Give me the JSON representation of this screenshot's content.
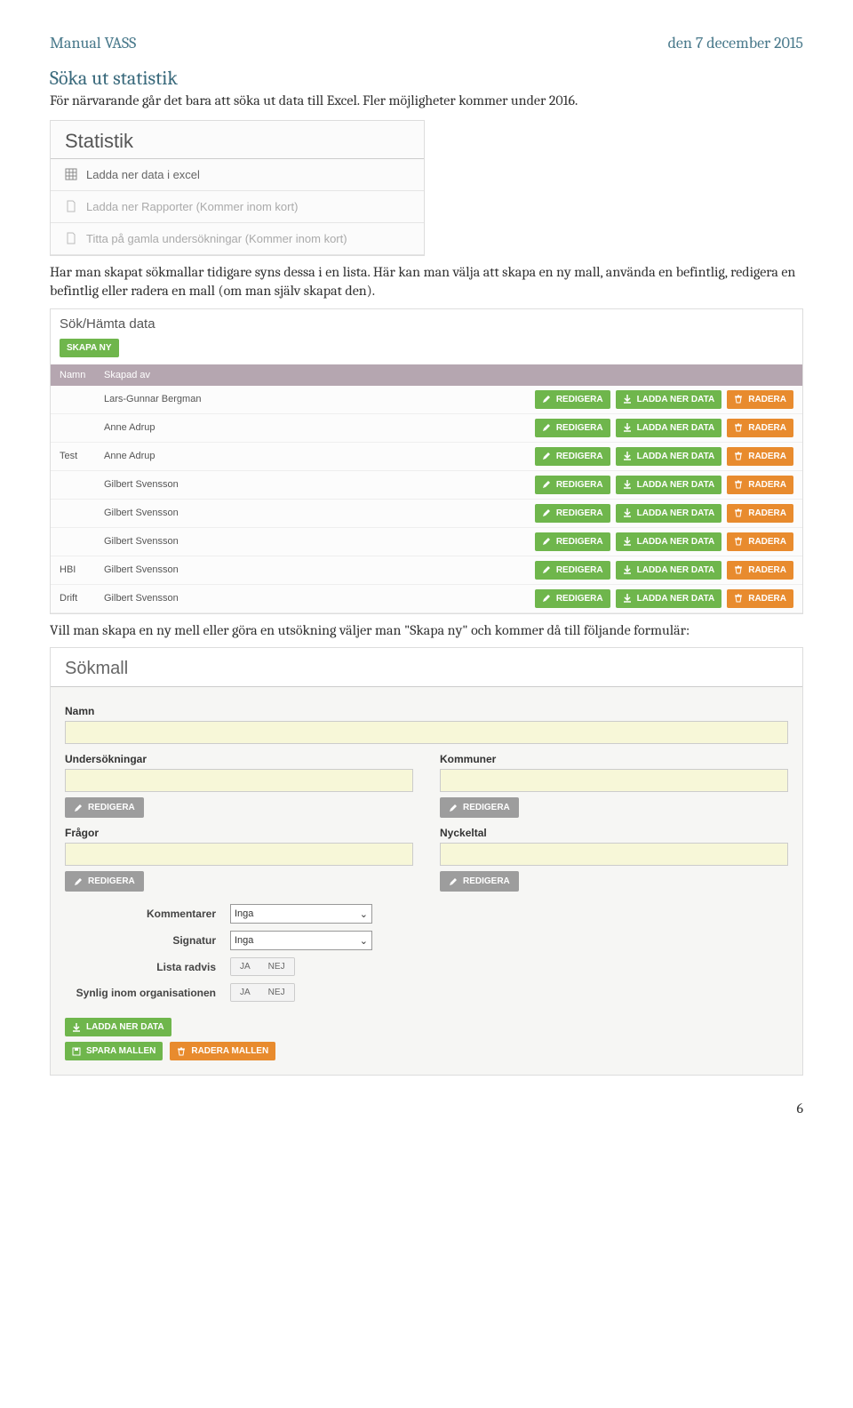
{
  "header": {
    "left": "Manual VASS",
    "right": "den 7 december 2015"
  },
  "h2": "Söka ut statistik",
  "p1": "För närvarande går det bara att söka ut data till Excel. Fler möjligheter kommer under 2016.",
  "stat": {
    "title": "Statistik",
    "r1": "Ladda ner data i excel",
    "r2": "Ladda ner Rapporter (Kommer inom kort)",
    "r3": "Titta på gamla undersökningar (Kommer inom kort)"
  },
  "p2": "Har man skapat sökmallar tidigare syns dessa i en lista. Här kan man välja att skapa en ny mall, använda en befintlig, redigera en befintlig eller radera en mall (om man själv skapat den).",
  "list": {
    "title": "Sök/Hämta data",
    "skapa": "SKAPA NY",
    "h1": "Namn",
    "h2": "Skapad av",
    "btn_edit": "REDIGERA",
    "btn_dl": "LADDA NER DATA",
    "btn_del": "RADERA",
    "rows": [
      {
        "n": "",
        "a": "Lars-Gunnar Bergman"
      },
      {
        "n": "",
        "a": "Anne Adrup"
      },
      {
        "n": "Test",
        "a": "Anne Adrup"
      },
      {
        "n": "",
        "a": "Gilbert Svensson"
      },
      {
        "n": "",
        "a": "Gilbert Svensson"
      },
      {
        "n": "",
        "a": "Gilbert Svensson"
      },
      {
        "n": "HBI",
        "a": "Gilbert Svensson"
      },
      {
        "n": "Drift",
        "a": "Gilbert Svensson"
      }
    ]
  },
  "p3": "Vill man skapa en ny mell eller göra en utsökning väljer man \"Skapa ny\" och kommer då till följande formulär:",
  "form": {
    "title": "Sökmall",
    "namn": "Namn",
    "und": "Undersökningar",
    "kom": "Kommuner",
    "fra": "Frågor",
    "nyc": "Nyckeltal",
    "redigera": "REDIGERA",
    "komment": "Kommentarer",
    "sign": "Signatur",
    "lista": "Lista radvis",
    "synlig": "Synlig inom organisationen",
    "inga": "Inga",
    "ja": "JA",
    "nej": "NEJ",
    "ladda": "LADDA NER DATA",
    "spara": "SPARA MALLEN",
    "radera": "RADERA MALLEN"
  },
  "pagenum": "6"
}
